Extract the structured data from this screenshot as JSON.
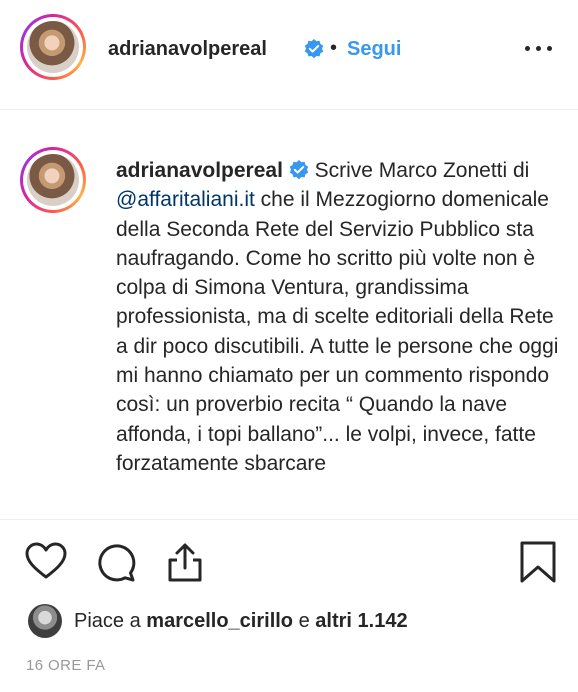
{
  "header": {
    "username": "adrianavolpereal",
    "separator": "•",
    "follow_label": "Segui",
    "more_icon": "more-options-icon"
  },
  "caption": {
    "username": "adrianavolpereal",
    "part1": "Scrive Marco Zonetti di",
    "mention": "@affaritaliani.it",
    "part2": "che il Mezzogiorno domenicale della Seconda Rete del Servizio Pubblico sta naufragando. Come ho scritto più volte non è colpa di Simona Ventura, grandissima professionista, ma di scelte editoriali della Rete a dir poco discutibili. A tutte le persone che oggi mi hanno chiamato per un commento rispondo così: un proverbio recita “ Quando la nave affonda, i topi ballano”... le volpi, invece, fatte forzatamente sbarcare"
  },
  "actions": {
    "like_icon": "heart-icon",
    "comment_icon": "comment-icon",
    "share_icon": "share-icon",
    "save_icon": "bookmark-icon"
  },
  "likes": {
    "prefix": "Piace a",
    "user": "marcello_cirillo",
    "middle": "e",
    "others": "altri 1.142"
  },
  "timestamp": "16 ORE FA",
  "colors": {
    "link_blue": "#3897f0",
    "mention_blue": "#003569",
    "text": "#262626",
    "muted": "#999999"
  }
}
